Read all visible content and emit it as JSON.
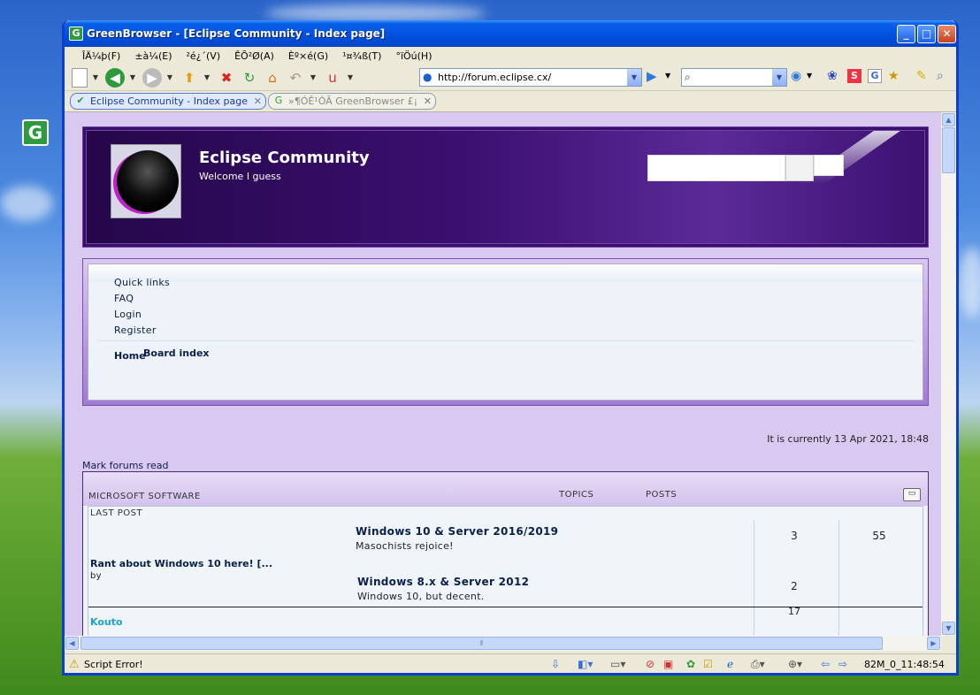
{
  "window": {
    "title": "GreenBrowser - [Eclipse Community - Index page]",
    "menu": [
      "ÎÄ¼þ(F)",
      "±à¼­(E)",
      "²é¿´(V)",
      "ÊÕ²Ø(A)",
      "Èº×é(G)",
      "¹¤¾ß(T)",
      "°ïÖú(H)"
    ],
    "address": "http://forum.eclipse.cx/",
    "tabs": [
      {
        "label": "Eclipse Community - Index page"
      },
      {
        "label": "»¶Ó­Ê¹ÓÃ GreenBrowser £¡"
      }
    ],
    "status": {
      "text": "Script Error!",
      "clock": "82M_0_11:48:54"
    }
  },
  "page": {
    "site_title": "Eclipse Community",
    "site_desc": "Welcome I guess",
    "quick_links": "Quick links",
    "nav": [
      "FAQ",
      "Login",
      "Register"
    ],
    "crumb_home": "Home",
    "crumb_board": "Board index",
    "currently": "It is currently 13 Apr 2021, 18:48",
    "mark_read": "Mark forums read",
    "category": {
      "name": "MICROSOFT SOFTWARE",
      "col_topics": "TOPICS",
      "col_posts": "POSTS",
      "col_lastpost": "LAST POST"
    },
    "forums": [
      {
        "title": "Windows 10 & Server 2016/2019",
        "desc": "Masochists rejoice!",
        "topics": "3",
        "posts": "55"
      },
      {
        "title": "Windows 8.x & Server 2012",
        "desc": "Windows 10, but decent.",
        "topics": "2",
        "posts": ""
      }
    ],
    "last_post": {
      "title": "Rant about Windows 10 here! [...",
      "by": "by",
      "user": "Kouto"
    },
    "partial_number": "17"
  }
}
